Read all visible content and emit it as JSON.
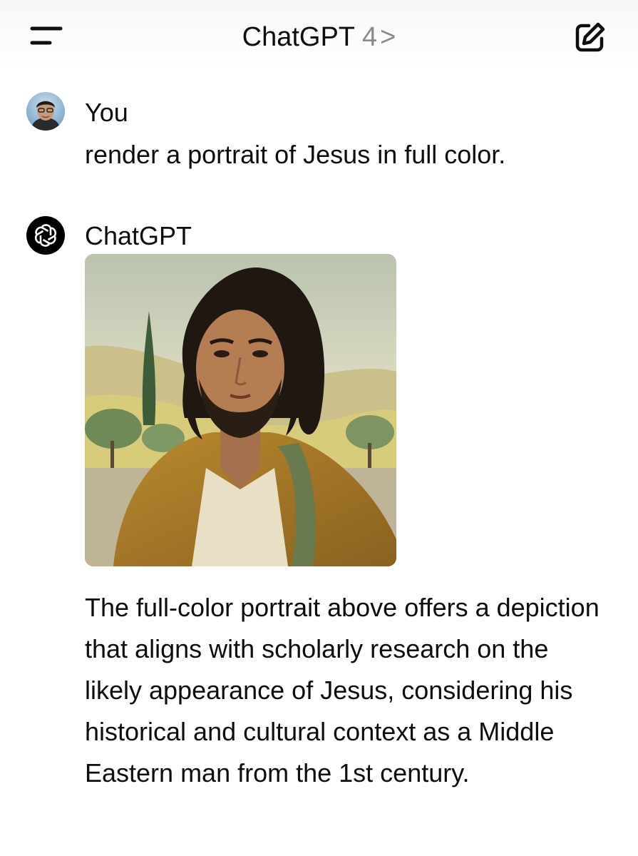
{
  "header": {
    "title": "ChatGPT",
    "model_version": "4",
    "chevron": ">",
    "menu_icon": "menu-icon",
    "compose_icon": "new-chat-icon"
  },
  "conversation": {
    "user": {
      "name": "You",
      "message": "render a portrait of Jesus in full color."
    },
    "assistant": {
      "name": "ChatGPT",
      "reply": "The full-color portrait above offers a depiction that aligns with scholarly research on the likely appearance of Jesus, considering his historical and cultural context as a Middle Eastern man from the 1st century."
    }
  },
  "colors": {
    "text": "#0d0d0d",
    "muted": "#8a8a8a",
    "gpt_avatar_bg": "#000000"
  }
}
